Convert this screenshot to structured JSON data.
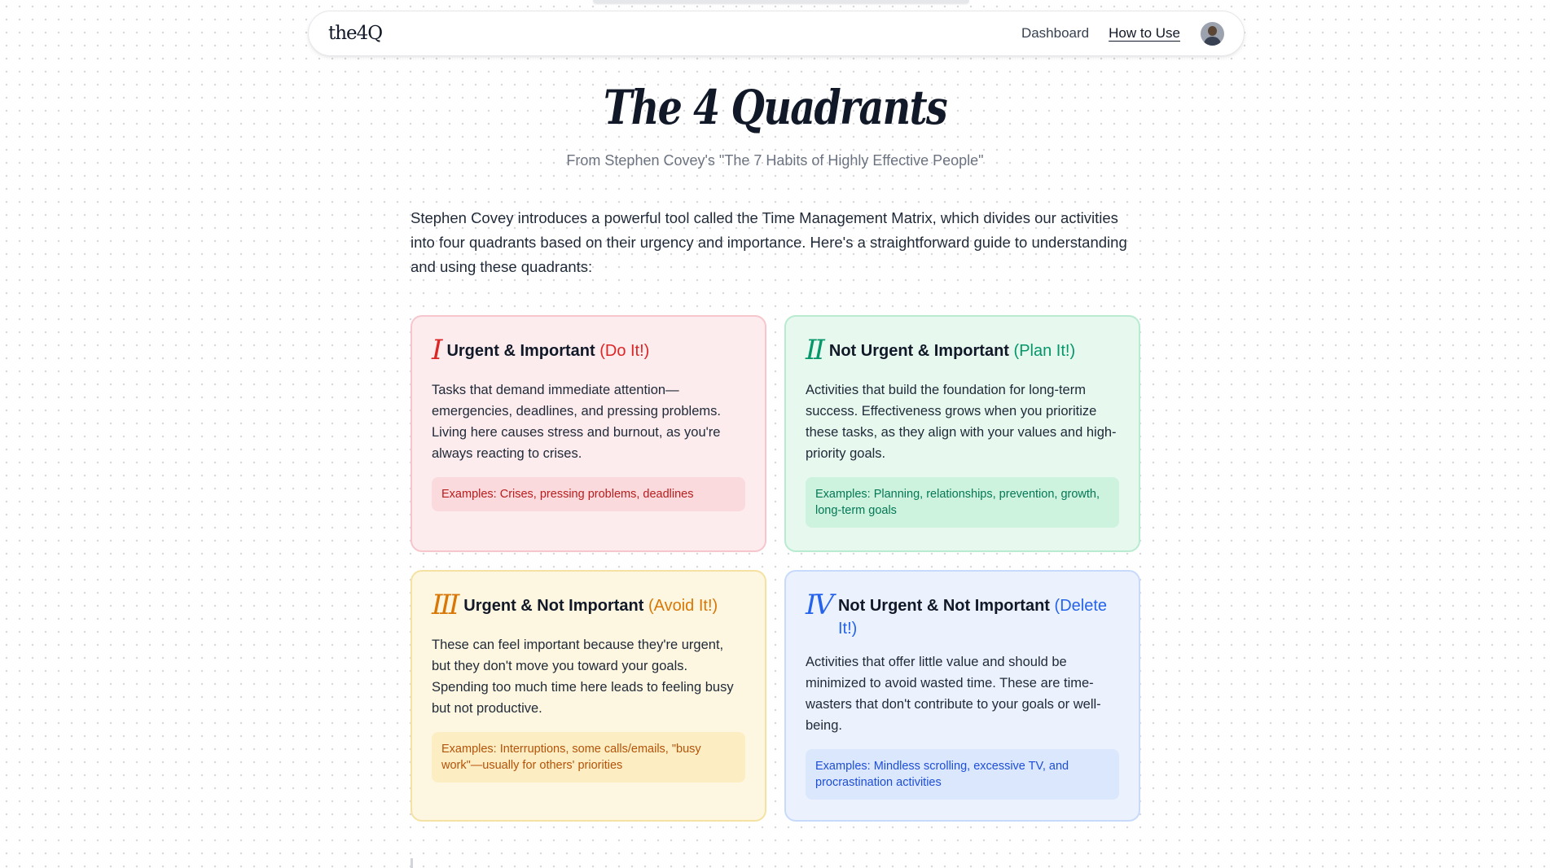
{
  "nav": {
    "logo": "the4Q",
    "links": [
      "Dashboard",
      "How to Use"
    ]
  },
  "page": {
    "title": "The 4 Quadrants",
    "subtitle": "From Stephen Covey's \"The 7 Habits of Highly Effective People\"",
    "intro": "Stephen Covey introduces a powerful tool called the Time Management Matrix, which divides our activities into four quadrants based on their urgency and importance. Here's a straightforward guide to understanding and using these quadrants:"
  },
  "quadrants": [
    {
      "numeral": "I",
      "title": "Urgent & Important",
      "tag": "(Do It!)",
      "body": "Tasks that demand immediate attention—emergencies, deadlines, and pressing problems. Living here causes stress and burnout, as you're always reacting to crises.",
      "examples": "Examples: Crises, pressing problems, deadlines",
      "color": "#dc2626"
    },
    {
      "numeral": "II",
      "title": "Not Urgent & Important",
      "tag": "(Plan It!)",
      "body": "Activities that build the foundation for long-term success. Effectiveness grows when you prioritize these tasks, as they align with your values and high-priority goals.",
      "examples": "Examples: Planning, relationships, prevention, growth, long-term goals",
      "color": "#059669"
    },
    {
      "numeral": "III",
      "title": "Urgent & Not Important",
      "tag": "(Avoid It!)",
      "body": "These can feel important because they're urgent, but they don't move you toward your goals. Spending too much time here leads to feeling busy but not productive.",
      "examples": "Examples: Interruptions, some calls/emails, \"busy work\"—usually for others' priorities",
      "color": "#d97706"
    },
    {
      "numeral": "IV",
      "title": "Not Urgent & Not Important",
      "tag": "(Delete It!)",
      "body": "Activities that offer little value and should be minimized to avoid wasted time. These are time-wasters that don't contribute to your goals or well-being.",
      "examples": "Examples: Mindless scrolling, excessive TV, and procrastination activities",
      "color": "#2563eb"
    }
  ]
}
